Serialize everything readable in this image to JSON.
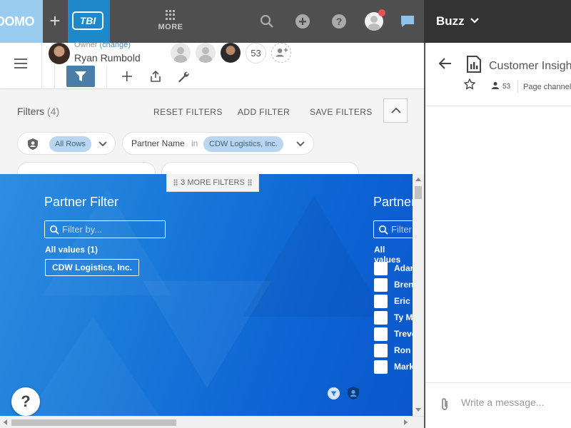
{
  "nav": {
    "brand_logo": "DOMO",
    "tbi_logo": "TBI",
    "more_label": "MORE",
    "icons": [
      "plus-icon",
      "search-icon",
      "add-circle-icon",
      "help-icon",
      "user-avatar-icon",
      "chat-icon"
    ],
    "notification_color": "#ec5151"
  },
  "buzz": {
    "header_title": "Buzz",
    "channel_title": "Customer Insights",
    "member_count": "53",
    "channel_type": "Page channel",
    "message_placeholder": "Write a message..."
  },
  "page_header": {
    "owner_label": "Owner",
    "change_link": "(change)",
    "owner_name": "Ryan Rumbold",
    "member_count": "53"
  },
  "filters": {
    "title": "Filters",
    "count": "(4)",
    "actions": {
      "reset": "RESET FILTERS",
      "add": "ADD FILTER",
      "save": "SAVE FILTERS"
    },
    "pills": [
      {
        "value": "All Rows"
      },
      {
        "label": "Partner Name",
        "in": "in",
        "value": "CDW Logistics, Inc."
      }
    ],
    "more_filters": "3 MORE FILTERS"
  },
  "card": {
    "left_filter": {
      "title": "Partner Filter",
      "search_placeholder": "Filter by...",
      "all_values": "All values (1)",
      "selected": "CDW Logistics, Inc."
    },
    "right_filter": {
      "title": "Partner",
      "search_placeholder": "Filter",
      "all_values": "All values",
      "options": [
        "Adam",
        "Brent",
        "Eric B",
        "Ty M",
        "Trevor",
        "Ron",
        "Mark"
      ]
    },
    "help_label": "?",
    "gradient_colors": [
      "#2e8ee0",
      "#0a57cc"
    ]
  }
}
